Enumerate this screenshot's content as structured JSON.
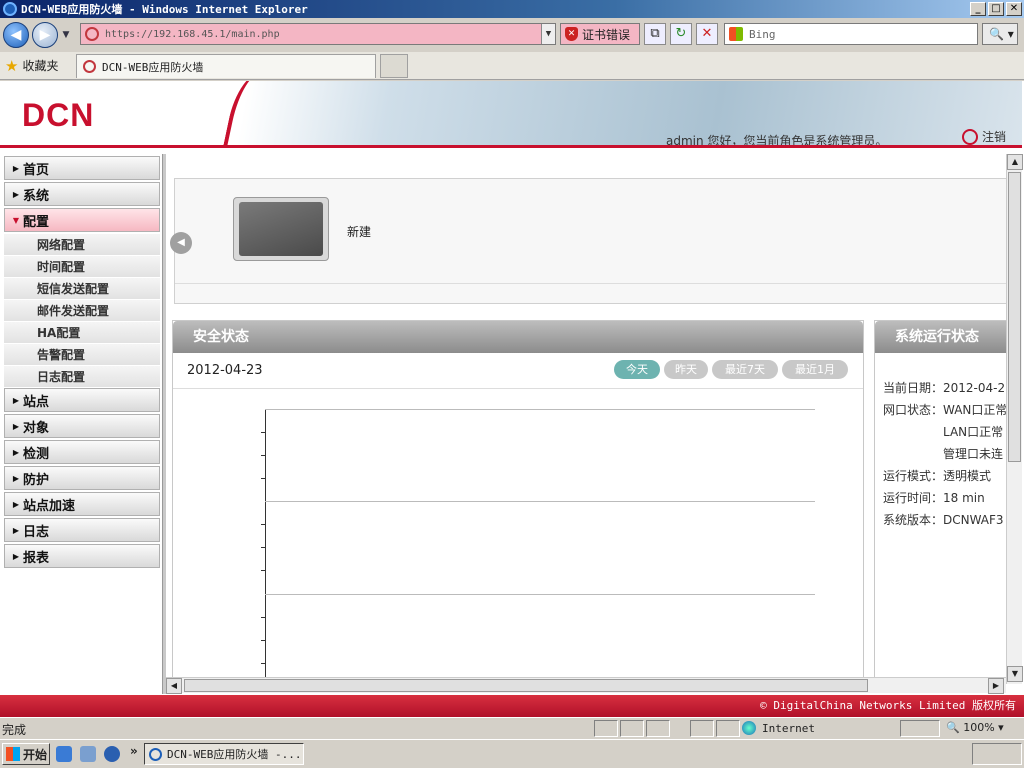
{
  "window": {
    "title": "DCN-WEB应用防火墙 - Windows Internet Explorer",
    "min": "_",
    "max": "□",
    "close": "✕"
  },
  "toolbar": {
    "address": "https://192.168.45.1/main.php",
    "cert_error": "证书错误",
    "search_placeholder": "Bing"
  },
  "favorites": {
    "label": "收藏夹",
    "tab_title": "DCN-WEB应用防火墙"
  },
  "header": {
    "logo": "DCN",
    "greeting": "admin 您好，您当前角色是系统管理员。",
    "logout": "注销"
  },
  "sidebar": {
    "items": [
      {
        "label": "首页",
        "expanded": false
      },
      {
        "label": "系统",
        "expanded": false
      },
      {
        "label": "配置",
        "expanded": true
      },
      {
        "label": "站点",
        "expanded": false
      },
      {
        "label": "对象",
        "expanded": false
      },
      {
        "label": "检测",
        "expanded": false
      },
      {
        "label": "防护",
        "expanded": false
      },
      {
        "label": "站点加速",
        "expanded": false
      },
      {
        "label": "日志",
        "expanded": false
      },
      {
        "label": "报表",
        "expanded": false
      }
    ],
    "sub_items": [
      "网络配置",
      "时间配置",
      "短信发送配置",
      "邮件发送配置",
      "HA配置",
      "告警配置",
      "日志配置"
    ]
  },
  "quick": {
    "new_label": "新建"
  },
  "security": {
    "title": "安全状态",
    "date": "2012-04-23",
    "ranges": [
      "今天",
      "昨天",
      "最近7天",
      "最近1月"
    ],
    "active_range": "今天"
  },
  "system": {
    "title": "系统运行状态",
    "rows": [
      {
        "key": "当前日期：",
        "value": "2012-04-2"
      },
      {
        "key": "网口状态：",
        "value": "WAN口正常"
      },
      {
        "key": "",
        "value": "LAN口正常"
      },
      {
        "key": "",
        "value": "管理口未连"
      },
      {
        "key": "运行模式：",
        "value": "透明模式"
      },
      {
        "key": "运行时间：",
        "value": "18 min"
      },
      {
        "key": "系统版本：",
        "value": "DCNWAF3"
      }
    ]
  },
  "footer": {
    "copyright": "© DigitalChina Networks Limited 版权所有"
  },
  "statusbar": {
    "status": "完成",
    "zone": "Internet",
    "zoom": "100%"
  },
  "taskbar": {
    "start": "开始",
    "task": "DCN-WEB应用防火墙 -..."
  },
  "colors": {
    "brand_red": "#c8102e",
    "active_pill": "#6db3b0"
  }
}
